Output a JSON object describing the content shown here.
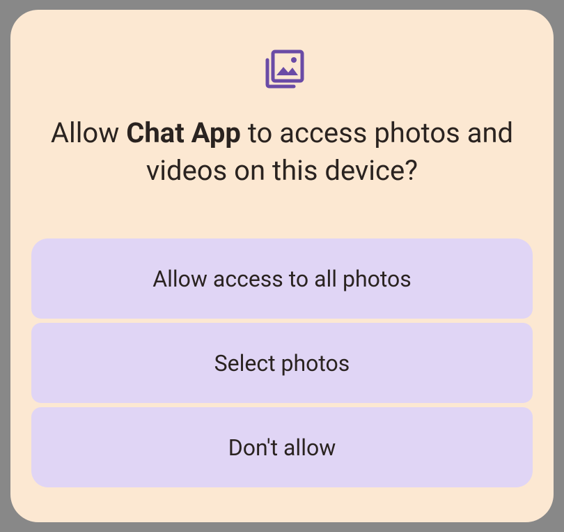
{
  "dialog": {
    "title_prefix": "Allow ",
    "app_name": "Chat App",
    "title_suffix": " to access photos and videos on this device?",
    "icon": "photo-library-icon",
    "accent_color": "#6a4ba6"
  },
  "options": [
    {
      "label": "Allow access to all photos"
    },
    {
      "label": "Select photos"
    },
    {
      "label": "Don't allow"
    }
  ]
}
